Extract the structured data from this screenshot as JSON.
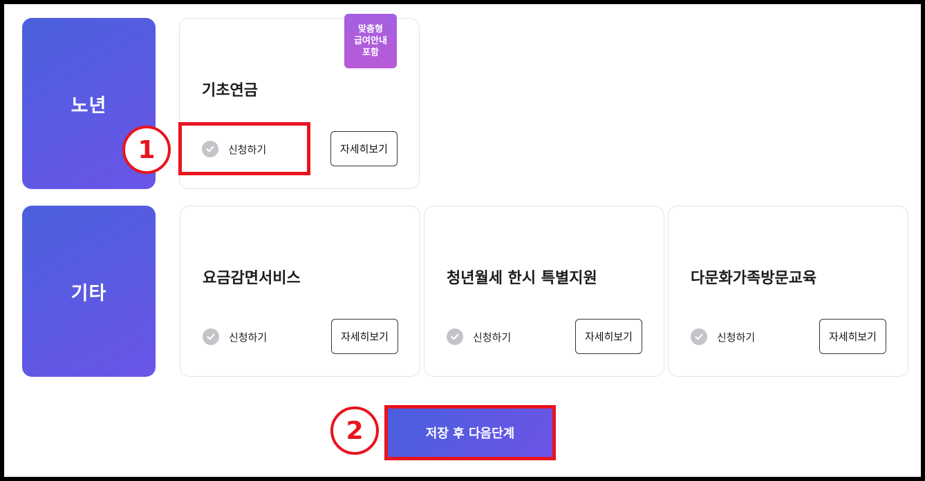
{
  "categories": {
    "senior": {
      "label": "노년",
      "cards": [
        {
          "title": "기초연금",
          "apply_label": "신청하기",
          "detail_label": "자세히보기",
          "badge": "맞춤형\n급여안내\n포함"
        }
      ]
    },
    "other": {
      "label": "기타",
      "cards": [
        {
          "title": "요금감면서비스",
          "apply_label": "신청하기",
          "detail_label": "자세히보기"
        },
        {
          "title": "청년월세 한시 특별지원",
          "apply_label": "신청하기",
          "detail_label": "자세히보기"
        },
        {
          "title": "다문화가족방문교육",
          "apply_label": "신청하기",
          "detail_label": "자세히보기"
        }
      ]
    }
  },
  "annotations": {
    "step1": "1",
    "step2": "2"
  },
  "footer": {
    "save_label": "저장 후 다음단계"
  },
  "colors": {
    "accent_start": "#4b60dc",
    "accent_end": "#6a55e8",
    "badge": "#a360e0",
    "highlight": "#e8141e",
    "check": "#c3c3c8"
  }
}
